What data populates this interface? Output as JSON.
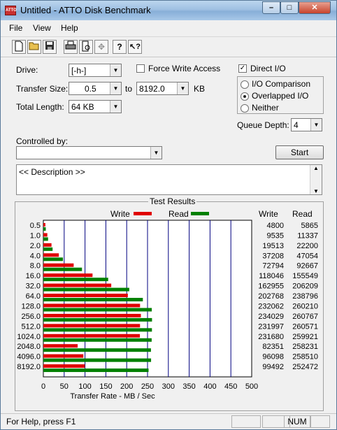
{
  "window": {
    "title": "Untitled - ATTO Disk Benchmark",
    "app_icon_text": "ATTO",
    "controls": {
      "minimize": "–",
      "maximize": "□",
      "close": "✕"
    }
  },
  "menu": [
    "File",
    "View",
    "Help"
  ],
  "toolbar": [
    "new-icon",
    "open-icon",
    "save-icon",
    "print-icon",
    "print-preview-icon",
    "move-icon",
    "help-icon",
    "context-help-icon"
  ],
  "form": {
    "drive_label": "Drive:",
    "drive_value": "[-h-]",
    "force_write_label": "Force Write Access",
    "force_write_checked": false,
    "direct_io_label": "Direct I/O",
    "direct_io_checked": true,
    "transfer_size_label": "Transfer Size:",
    "transfer_from": "0.5",
    "to_label": "to",
    "transfer_to": "8192.0",
    "kb_label": "KB",
    "total_length_label": "Total Length:",
    "total_length_value": "64 KB",
    "io_modes": [
      {
        "label": "I/O Comparison",
        "selected": false
      },
      {
        "label": "Overlapped I/O",
        "selected": true
      },
      {
        "label": "Neither",
        "selected": false
      }
    ],
    "queue_depth_label": "Queue Depth:",
    "queue_depth_value": "4",
    "controlled_by_label": "Controlled by:",
    "controlled_by_value": "",
    "start_label": "Start",
    "description": "<< Description >>"
  },
  "results": {
    "title": "Test Results",
    "legend_write": "Write",
    "legend_read": "Read",
    "col_write": "Write",
    "col_read": "Read"
  },
  "chart_data": {
    "type": "bar",
    "orientation": "horizontal",
    "categories": [
      "0.5",
      "1.0",
      "2.0",
      "4.0",
      "8.0",
      "16.0",
      "32.0",
      "64.0",
      "128.0",
      "256.0",
      "512.0",
      "1024.0",
      "2048.0",
      "4096.0",
      "8192.0"
    ],
    "series": [
      {
        "name": "Write",
        "color": "#e00000",
        "values": [
          4800,
          9535,
          19513,
          37208,
          72794,
          118046,
          162955,
          202768,
          232062,
          234029,
          231997,
          231680,
          82351,
          96098,
          99492
        ]
      },
      {
        "name": "Read",
        "color": "#008000",
        "values": [
          5865,
          11337,
          22200,
          47054,
          92667,
          155549,
          206209,
          238796,
          260210,
          260767,
          260571,
          259921,
          258231,
          258510,
          252472
        ]
      }
    ],
    "xlabel": "Transfer Rate - MB / Sec",
    "xticks": [
      "0",
      "50",
      "100",
      "150",
      "200",
      "250",
      "300",
      "350",
      "400",
      "450",
      "500"
    ],
    "xlim": [
      0,
      500
    ],
    "value_unit": "KB/s"
  },
  "status": {
    "text": "For Help, press F1",
    "num": "NUM"
  }
}
